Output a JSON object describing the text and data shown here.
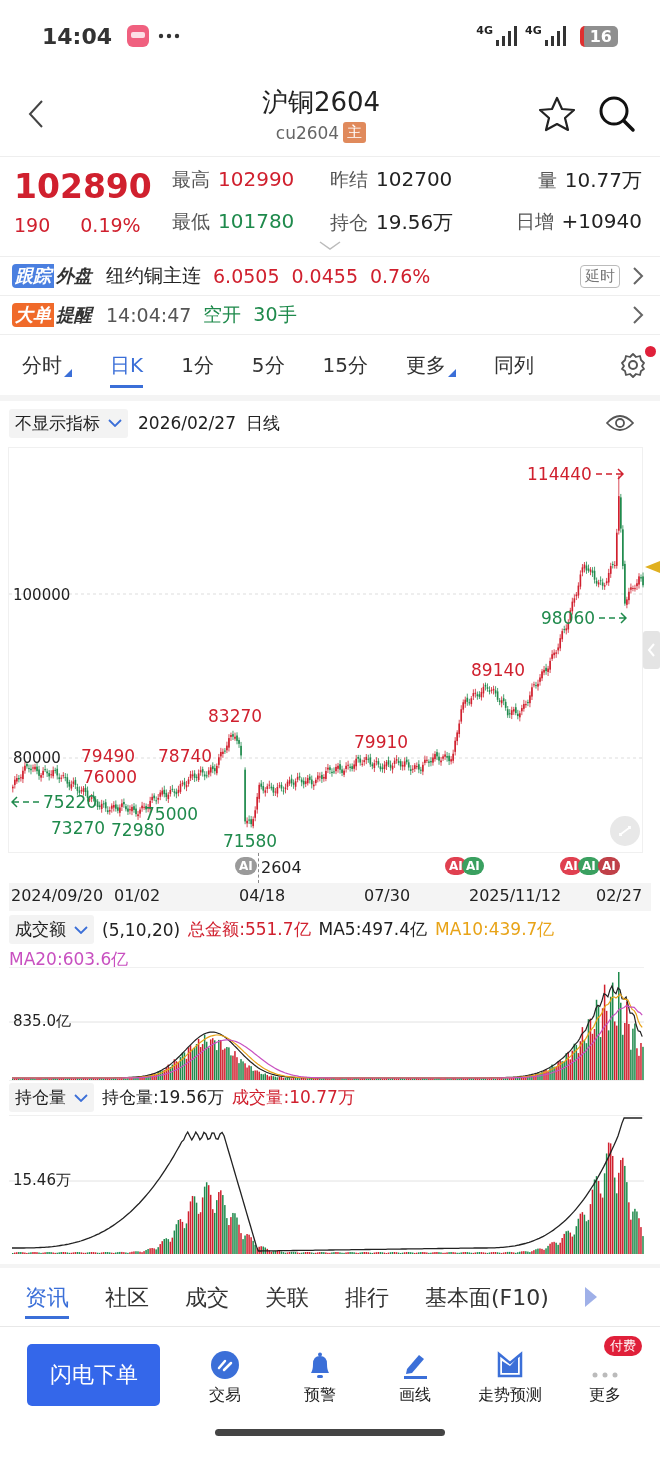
{
  "status_bar": {
    "time": "14:04",
    "networks": [
      "4G",
      "4G"
    ],
    "battery": "16"
  },
  "header": {
    "title": "沪铜2604",
    "code": "cu2604",
    "badge": "主"
  },
  "quote": {
    "price": "102890",
    "change": "190",
    "change_pct": "0.19%",
    "stats": [
      {
        "label": "最高",
        "value": "102990",
        "color": "#d0202e"
      },
      {
        "label": "昨结",
        "value": "102700",
        "color": "#222222"
      },
      {
        "label": "量",
        "value": "10.77万",
        "color": "#222222"
      },
      {
        "label": "最低",
        "value": "101780",
        "color": "#1f8a4c"
      },
      {
        "label": "持仓",
        "value": "19.56万",
        "color": "#222222"
      },
      {
        "label": "日增",
        "value": "+10940",
        "color": "#222222"
      }
    ]
  },
  "foreign": {
    "tag": "跟踪",
    "tag_rest": "外盘",
    "name": "纽约铜主连",
    "values": [
      "6.0505",
      "0.0455",
      "0.76%"
    ],
    "delay": "延时"
  },
  "big_order": {
    "tag": "大单",
    "tag_rest": "提醒",
    "time": "14:04:47",
    "action": "空开",
    "qty": "30手"
  },
  "periods": [
    {
      "label": "分时",
      "selected": false,
      "menu": true
    },
    {
      "label": "日K",
      "selected": true,
      "menu": false
    },
    {
      "label": "1分",
      "selected": false,
      "menu": false
    },
    {
      "label": "5分",
      "selected": false,
      "menu": false
    },
    {
      "label": "15分",
      "selected": false,
      "menu": false
    },
    {
      "label": "更多",
      "selected": false,
      "menu": true
    },
    {
      "label": "同列",
      "selected": false,
      "menu": false
    }
  ],
  "settings_dot": true,
  "indicator": {
    "selector": "不显示指标",
    "date": "2026/02/27",
    "period": "日线"
  },
  "chart": {
    "y_labels": [
      "100000",
      "80000"
    ],
    "annotations": [
      {
        "text": "114440",
        "color": "#d0202e",
        "arrow_left": false,
        "arrow_right": true
      },
      {
        "text": "98060",
        "color": "#1f8a4c",
        "arrow_left": false,
        "arrow_right": true
      },
      {
        "text": "89140",
        "color": "#d0202e",
        "arrow_left": false,
        "arrow_right": false
      },
      {
        "text": "83270",
        "color": "#d0202e",
        "arrow_left": false,
        "arrow_right": false
      },
      {
        "text": "79910",
        "color": "#d0202e",
        "arrow_left": false,
        "arrow_right": false
      },
      {
        "text": "79490",
        "color": "#d0202e",
        "arrow_left": false,
        "arrow_right": false
      },
      {
        "text": "78740",
        "color": "#d0202e",
        "arrow_left": false,
        "arrow_right": false
      },
      {
        "text": "76000",
        "color": "#d0202e",
        "arrow_left": false,
        "arrow_right": false
      },
      {
        "text": "75220",
        "color": "#1f8a4c",
        "arrow_left": true,
        "arrow_right": false
      },
      {
        "text": "75000",
        "color": "#1f8a4c",
        "arrow_left": false,
        "arrow_right": false
      },
      {
        "text": "73270",
        "color": "#1f8a4c",
        "arrow_left": false,
        "arrow_right": false
      },
      {
        "text": "72980",
        "color": "#1f8a4c",
        "arrow_left": false,
        "arrow_right": false
      },
      {
        "text": "71580",
        "color": "#1f8a4c",
        "arrow_left": false,
        "arrow_right": false
      }
    ],
    "contract": "2604",
    "ai_markers": [
      {
        "label": "AI",
        "color": "#9a9a9a"
      },
      {
        "label": "AI",
        "color": "#e04050"
      },
      {
        "label": "AI",
        "color": "#3aa060"
      },
      {
        "label": "AI",
        "color": "#e04050"
      },
      {
        "label": "AI",
        "color": "#3aa060"
      },
      {
        "label": "AI",
        "color": "#c04048"
      }
    ],
    "x_labels": [
      "2024/09/20",
      "01/02",
      "04/18",
      "07/30",
      "2025/11/12",
      "02/27"
    ]
  },
  "volume": {
    "selector": "成交额",
    "params": "(5,10,20)",
    "legends": [
      {
        "text": "总金额:551.7亿",
        "color": "#d0202e"
      },
      {
        "text": "MA5:497.4亿",
        "color": "#222222"
      },
      {
        "text": "MA10:439.7亿",
        "color": "#e8a317"
      },
      {
        "text": "MA20:603.6亿",
        "color": "#c850c0"
      }
    ],
    "y_label": "835.0亿"
  },
  "open_interest": {
    "selector": "持仓量",
    "legends": [
      {
        "text": "持仓量:19.56万",
        "color": "#222222"
      },
      {
        "text": "成交量:10.77万",
        "color": "#d0202e"
      }
    ],
    "y_label": "15.46万"
  },
  "bottom_tabs": [
    {
      "label": "资讯",
      "selected": true
    },
    {
      "label": "社区",
      "selected": false
    },
    {
      "label": "成交",
      "selected": false
    },
    {
      "label": "关联",
      "selected": false
    },
    {
      "label": "排行",
      "selected": false
    },
    {
      "label": "基本面(F10)",
      "selected": false
    }
  ],
  "actions": {
    "primary": "闪电下单",
    "items": [
      {
        "label": "交易"
      },
      {
        "label": "预警"
      },
      {
        "label": "画线"
      },
      {
        "label": "走势预测"
      },
      {
        "label": "更多",
        "badge": "付费"
      }
    ]
  }
}
